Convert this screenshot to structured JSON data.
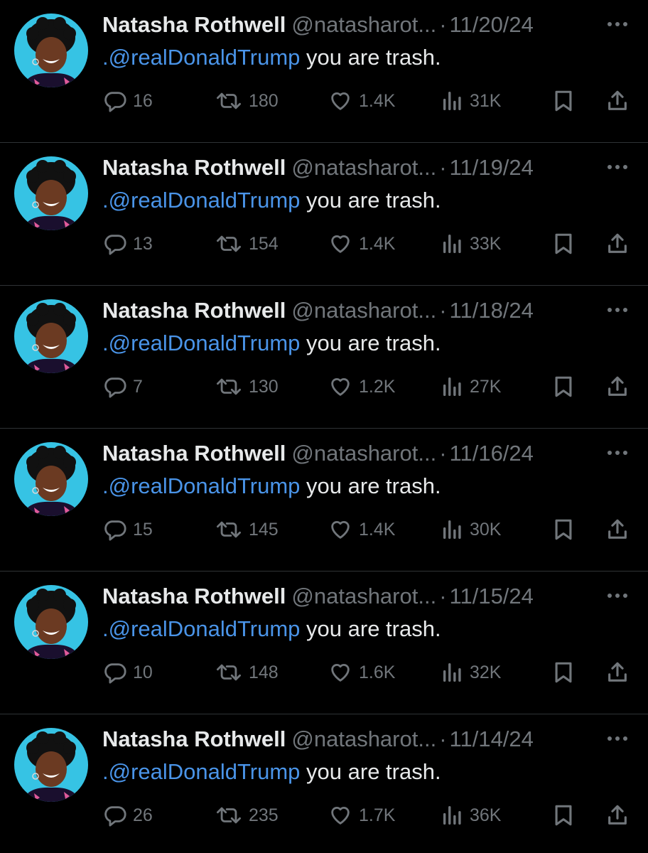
{
  "feed": {
    "tweets": [
      {
        "name": "Natasha Rothwell",
        "handle": "@natasharot...",
        "separator": "·",
        "date": "11/20/24",
        "mention": ".@realDonaldTrump",
        "text": " you are trash.",
        "replies": "16",
        "reposts": "180",
        "likes": "1.4K",
        "views": "31K"
      },
      {
        "name": "Natasha Rothwell",
        "handle": "@natasharot...",
        "separator": "·",
        "date": "11/19/24",
        "mention": ".@realDonaldTrump",
        "text": " you are trash.",
        "replies": "13",
        "reposts": "154",
        "likes": "1.4K",
        "views": "33K"
      },
      {
        "name": "Natasha Rothwell",
        "handle": "@natasharot...",
        "separator": "·",
        "date": "11/18/24",
        "mention": ".@realDonaldTrump",
        "text": " you are trash.",
        "replies": "7",
        "reposts": "130",
        "likes": "1.2K",
        "views": "27K"
      },
      {
        "name": "Natasha Rothwell",
        "handle": "@natasharot...",
        "separator": "·",
        "date": "11/16/24",
        "mention": ".@realDonaldTrump",
        "text": " you are trash.",
        "replies": "15",
        "reposts": "145",
        "likes": "1.4K",
        "views": "30K"
      },
      {
        "name": "Natasha Rothwell",
        "handle": "@natasharot...",
        "separator": "·",
        "date": "11/15/24",
        "mention": ".@realDonaldTrump",
        "text": " you are trash.",
        "replies": "10",
        "reposts": "148",
        "likes": "1.6K",
        "views": "32K"
      },
      {
        "name": "Natasha Rothwell",
        "handle": "@natasharot...",
        "separator": "·",
        "date": "11/14/24",
        "mention": ".@realDonaldTrump",
        "text": " you are trash.",
        "replies": "26",
        "reposts": "235",
        "likes": "1.7K",
        "views": "36K"
      }
    ]
  },
  "icons": {
    "avatar": "avatar-photo",
    "more": "more-horizontal-icon",
    "reply": "reply-icon",
    "repost": "repost-icon",
    "like": "heart-icon",
    "views": "views-chart-icon",
    "bookmark": "bookmark-icon",
    "share": "share-icon"
  },
  "colors": {
    "background": "#000000",
    "text": "#e7e9ea",
    "muted": "#71767b",
    "mention": "#4a94e8",
    "divider": "#2f3336",
    "avatar_bg": "#36c3e4"
  }
}
